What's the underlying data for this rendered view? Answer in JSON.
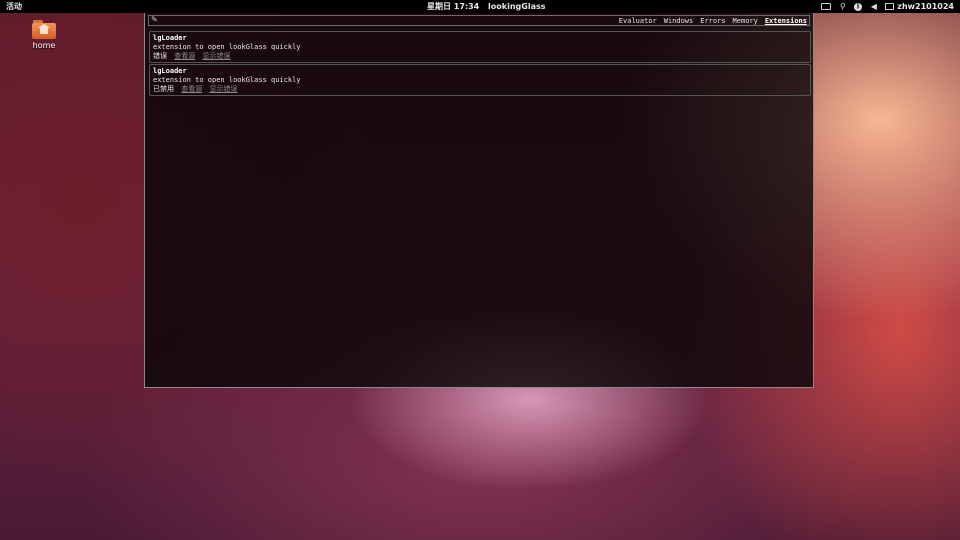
{
  "top_panel": {
    "activities": "活动",
    "date": "星期日 17:34",
    "app_name": "lookingGlass",
    "username": "zhw2101024"
  },
  "desktop": {
    "home_label": "home"
  },
  "looking_glass": {
    "tabs": [
      {
        "label": "Evaluator"
      },
      {
        "label": "Windows"
      },
      {
        "label": "Errors"
      },
      {
        "label": "Memory"
      },
      {
        "label": "Extensions",
        "active": true
      }
    ],
    "extensions": [
      {
        "name": "lgLoader",
        "description": "extension to open lookGlass quickly",
        "status": "错误",
        "links": [
          "查看源",
          "显示错误"
        ]
      },
      {
        "name": "lgLoader",
        "description": "extension to open lookGlass quickly",
        "status": "已禁用",
        "links": [
          "查看源",
          "显示错误"
        ]
      }
    ]
  },
  "icons": {
    "picker": "eyedropper-icon",
    "keyboard": "keyboard-icon",
    "network": "network-icon",
    "bluetooth": "bluetooth-icon",
    "volume": "volume-icon",
    "mail": "mail-icon",
    "folder": "home-folder-icon"
  }
}
